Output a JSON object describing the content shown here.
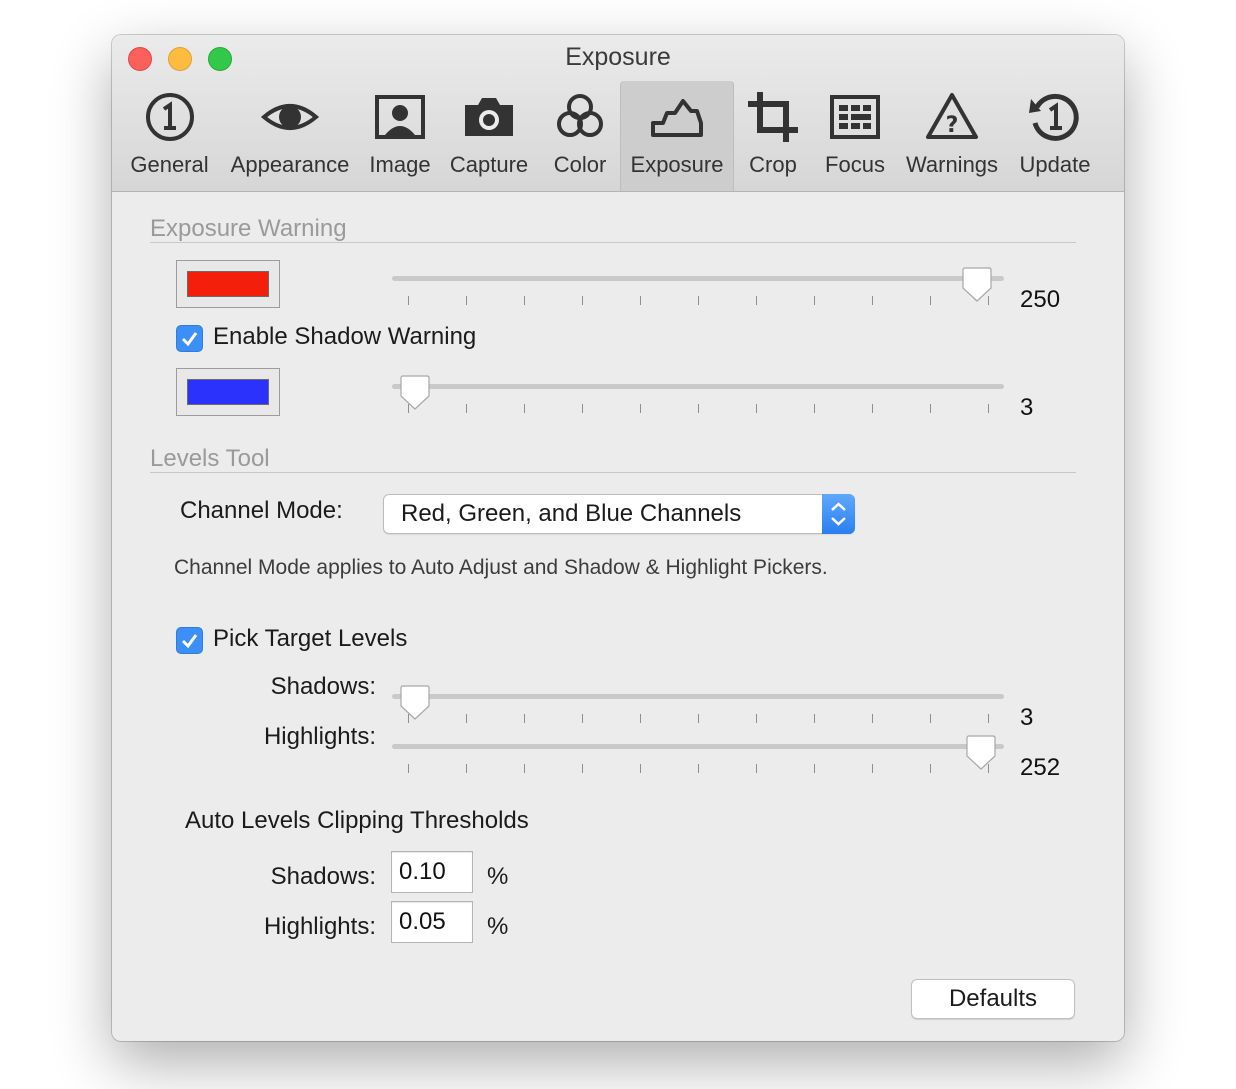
{
  "window": {
    "title": "Exposure",
    "traffic_colors": {
      "close": "#fc605c",
      "minimize": "#fdbc40",
      "zoom": "#34c84a"
    }
  },
  "toolbar": {
    "selected": "Exposure",
    "tabs": [
      {
        "label": "General",
        "icon": "general-icon"
      },
      {
        "label": "Appearance",
        "icon": "eye-icon"
      },
      {
        "label": "Image",
        "icon": "portrait-icon"
      },
      {
        "label": "Capture",
        "icon": "camera-icon"
      },
      {
        "label": "Color",
        "icon": "color-circles-icon"
      },
      {
        "label": "Exposure",
        "icon": "histogram-icon"
      },
      {
        "label": "Crop",
        "icon": "crop-icon"
      },
      {
        "label": "Focus",
        "icon": "focus-grid-icon"
      },
      {
        "label": "Warnings",
        "icon": "warning-triangle-icon"
      },
      {
        "label": "Update",
        "icon": "update-icon"
      }
    ]
  },
  "exposure_warning": {
    "section_title": "Exposure Warning",
    "highlight_swatch_color": "#f41f0a",
    "highlight_value": "250",
    "enable_shadow_label": "Enable Shadow Warning",
    "enable_shadow_checked": true,
    "shadow_swatch_color": "#2b32fb",
    "shadow_value": "3"
  },
  "levels_tool": {
    "section_title": "Levels Tool",
    "channel_mode_label": "Channel Mode:",
    "channel_mode_value": "Red, Green, and Blue Channels",
    "note": "Channel Mode applies to Auto Adjust and Shadow & Highlight Pickers.",
    "pick_target_label": "Pick Target Levels",
    "pick_target_checked": true,
    "shadows_label": "Shadows:",
    "shadows_value": "3",
    "highlights_label": "Highlights:",
    "highlights_value": "252",
    "clipping_title": "Auto Levels Clipping Thresholds",
    "clip_shadows_label": "Shadows:",
    "clip_shadows_value": "0.10",
    "clip_highlights_label": "Highlights:",
    "clip_highlights_value": "0.05",
    "percent_sign": "%",
    "defaults_button": "Defaults"
  },
  "slider_range": [
    0,
    255
  ],
  "accent_color": "#3b8ff7"
}
